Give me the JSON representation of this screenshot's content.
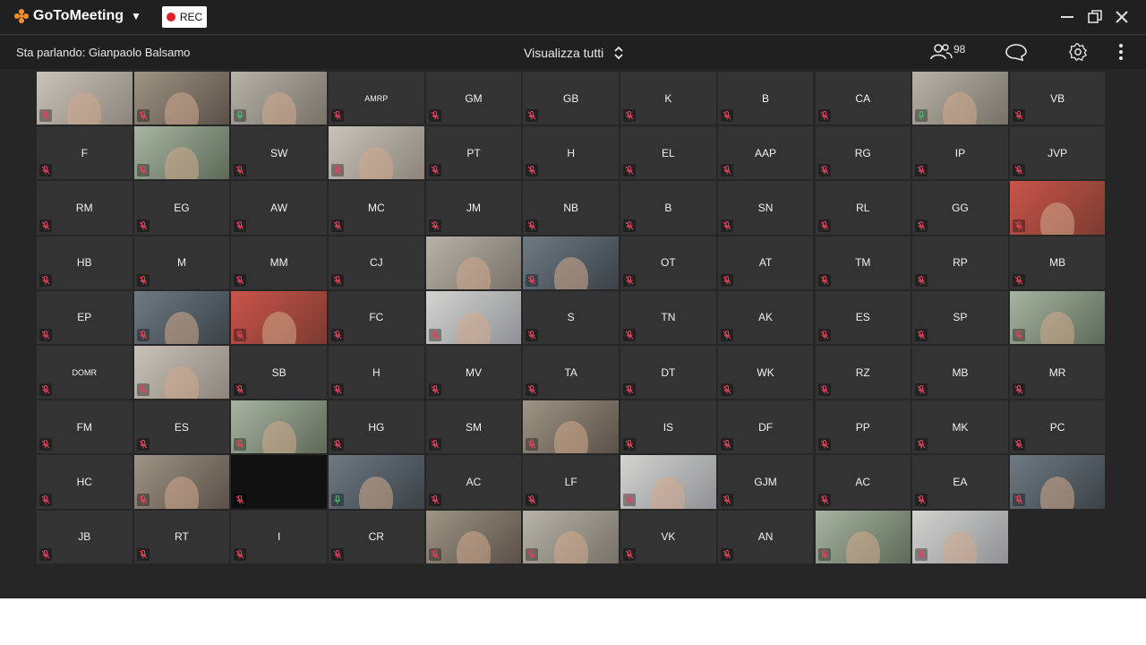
{
  "app": {
    "brand": "GoToMeeting",
    "rec_label": "REC",
    "speaking_label": "Sta parlando: Gianpaolo Balsamo",
    "view_label": "Visualizza tutti",
    "participants_count": "98",
    "colors": {
      "accent": "#f68d2e",
      "rec": "#e0202b",
      "mic_muted": "#e0435a",
      "mic_active": "#3cc26f"
    }
  },
  "tiles": [
    {
      "initials": "",
      "video": true,
      "mic": "muted"
    },
    {
      "initials": "",
      "video": true,
      "mic": "muted"
    },
    {
      "initials": "",
      "video": true,
      "mic": "active"
    },
    {
      "initials": "AMRP",
      "video": false,
      "mic": "muted"
    },
    {
      "initials": "GM",
      "video": false,
      "mic": "muted"
    },
    {
      "initials": "GB",
      "video": false,
      "mic": "muted"
    },
    {
      "initials": "K",
      "video": false,
      "mic": "muted"
    },
    {
      "initials": "B",
      "video": false,
      "mic": "muted"
    },
    {
      "initials": "CA",
      "video": false,
      "mic": "muted"
    },
    {
      "initials": "",
      "video": true,
      "mic": "active"
    },
    {
      "initials": "VB",
      "video": false,
      "mic": "muted"
    },
    {
      "initials": "F",
      "video": false,
      "mic": "muted"
    },
    {
      "initials": "",
      "video": true,
      "mic": "muted"
    },
    {
      "initials": "SW",
      "video": false,
      "mic": "muted"
    },
    {
      "initials": "",
      "video": true,
      "mic": "muted"
    },
    {
      "initials": "PT",
      "video": false,
      "mic": "muted"
    },
    {
      "initials": "H",
      "video": false,
      "mic": "muted"
    },
    {
      "initials": "EL",
      "video": false,
      "mic": "muted"
    },
    {
      "initials": "AAP",
      "video": false,
      "mic": "muted"
    },
    {
      "initials": "RG",
      "video": false,
      "mic": "muted"
    },
    {
      "initials": "IP",
      "video": false,
      "mic": "muted"
    },
    {
      "initials": "JVP",
      "video": false,
      "mic": "muted"
    },
    {
      "initials": "RM",
      "video": false,
      "mic": "muted"
    },
    {
      "initials": "EG",
      "video": false,
      "mic": "muted"
    },
    {
      "initials": "AW",
      "video": false,
      "mic": "muted"
    },
    {
      "initials": "MC",
      "video": false,
      "mic": "muted"
    },
    {
      "initials": "JM",
      "video": false,
      "mic": "muted"
    },
    {
      "initials": "NB",
      "video": false,
      "mic": "muted"
    },
    {
      "initials": "B",
      "video": false,
      "mic": "muted"
    },
    {
      "initials": "SN",
      "video": false,
      "mic": "muted"
    },
    {
      "initials": "RL",
      "video": false,
      "mic": "muted"
    },
    {
      "initials": "GG",
      "video": false,
      "mic": "muted"
    },
    {
      "initials": "",
      "video": true,
      "mic": "muted"
    },
    {
      "initials": "HB",
      "video": false,
      "mic": "muted"
    },
    {
      "initials": "M",
      "video": false,
      "mic": "muted"
    },
    {
      "initials": "MM",
      "video": false,
      "mic": "muted"
    },
    {
      "initials": "CJ",
      "video": false,
      "mic": "muted"
    },
    {
      "initials": "",
      "video": true,
      "mic": "none"
    },
    {
      "initials": "",
      "video": true,
      "mic": "muted"
    },
    {
      "initials": "OT",
      "video": false,
      "mic": "muted"
    },
    {
      "initials": "AT",
      "video": false,
      "mic": "muted"
    },
    {
      "initials": "TM",
      "video": false,
      "mic": "muted"
    },
    {
      "initials": "RP",
      "video": false,
      "mic": "muted"
    },
    {
      "initials": "MB",
      "video": false,
      "mic": "muted"
    },
    {
      "initials": "EP",
      "video": false,
      "mic": "muted"
    },
    {
      "initials": "",
      "video": true,
      "mic": "muted"
    },
    {
      "initials": "",
      "video": true,
      "mic": "muted"
    },
    {
      "initials": "FC",
      "video": false,
      "mic": "muted"
    },
    {
      "initials": "",
      "video": true,
      "mic": "muted"
    },
    {
      "initials": "S",
      "video": false,
      "mic": "muted"
    },
    {
      "initials": "TN",
      "video": false,
      "mic": "muted"
    },
    {
      "initials": "AK",
      "video": false,
      "mic": "muted"
    },
    {
      "initials": "ES",
      "video": false,
      "mic": "muted"
    },
    {
      "initials": "SP",
      "video": false,
      "mic": "muted"
    },
    {
      "initials": "",
      "video": true,
      "mic": "muted"
    },
    {
      "initials": "DOMR",
      "video": false,
      "mic": "muted"
    },
    {
      "initials": "",
      "video": true,
      "mic": "muted"
    },
    {
      "initials": "SB",
      "video": false,
      "mic": "muted"
    },
    {
      "initials": "H",
      "video": false,
      "mic": "muted"
    },
    {
      "initials": "MV",
      "video": false,
      "mic": "muted"
    },
    {
      "initials": "TA",
      "video": false,
      "mic": "muted"
    },
    {
      "initials": "DT",
      "video": false,
      "mic": "muted"
    },
    {
      "initials": "WK",
      "video": false,
      "mic": "muted"
    },
    {
      "initials": "RZ",
      "video": false,
      "mic": "muted"
    },
    {
      "initials": "MB",
      "video": false,
      "mic": "muted"
    },
    {
      "initials": "MR",
      "video": false,
      "mic": "muted"
    },
    {
      "initials": "FM",
      "video": false,
      "mic": "muted"
    },
    {
      "initials": "ES",
      "video": false,
      "mic": "muted"
    },
    {
      "initials": "",
      "video": true,
      "mic": "muted"
    },
    {
      "initials": "HG",
      "video": false,
      "mic": "muted"
    },
    {
      "initials": "SM",
      "video": false,
      "mic": "muted"
    },
    {
      "initials": "",
      "video": true,
      "mic": "muted"
    },
    {
      "initials": "IS",
      "video": false,
      "mic": "muted"
    },
    {
      "initials": "DF",
      "video": false,
      "mic": "muted"
    },
    {
      "initials": "PP",
      "video": false,
      "mic": "muted"
    },
    {
      "initials": "MK",
      "video": false,
      "mic": "muted"
    },
    {
      "initials": "PC",
      "video": false,
      "mic": "muted"
    },
    {
      "initials": "HC",
      "video": false,
      "mic": "muted"
    },
    {
      "initials": "",
      "video": true,
      "mic": "muted"
    },
    {
      "initials": "",
      "video": true,
      "mic": "muted",
      "dark": true
    },
    {
      "initials": "",
      "video": true,
      "mic": "active"
    },
    {
      "initials": "AC",
      "video": false,
      "mic": "muted"
    },
    {
      "initials": "LF",
      "video": false,
      "mic": "muted"
    },
    {
      "initials": "",
      "video": true,
      "mic": "muted"
    },
    {
      "initials": "GJM",
      "video": false,
      "mic": "muted"
    },
    {
      "initials": "AC",
      "video": false,
      "mic": "muted"
    },
    {
      "initials": "EA",
      "video": false,
      "mic": "muted"
    },
    {
      "initials": "",
      "video": true,
      "mic": "muted"
    },
    {
      "initials": "JB",
      "video": false,
      "mic": "muted"
    },
    {
      "initials": "RT",
      "video": false,
      "mic": "muted"
    },
    {
      "initials": "I",
      "video": false,
      "mic": "muted"
    },
    {
      "initials": "CR",
      "video": false,
      "mic": "muted"
    },
    {
      "initials": "",
      "video": true,
      "mic": "muted"
    },
    {
      "initials": "",
      "video": true,
      "mic": "muted"
    },
    {
      "initials": "VK",
      "video": false,
      "mic": "muted"
    },
    {
      "initials": "AN",
      "video": false,
      "mic": "muted"
    },
    {
      "initials": "",
      "video": true,
      "mic": "muted"
    },
    {
      "initials": "",
      "video": true,
      "mic": "muted"
    }
  ]
}
